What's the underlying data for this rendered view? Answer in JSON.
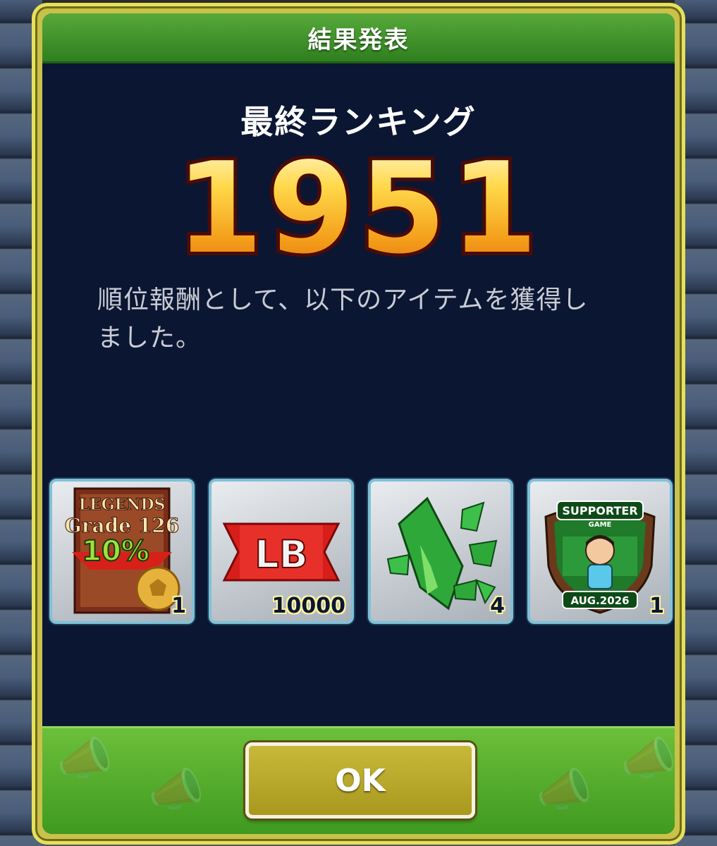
{
  "dialog": {
    "title": "結果発表",
    "ranking_label": "最終ランキング",
    "ranking_value": "1951",
    "message_line1": "順位報酬として、以下のアイテムを獲得し",
    "message_line2": "ました。",
    "ok_label": "OK"
  },
  "rewards": [
    {
      "name": "legends-grade-ticket",
      "top_text": "LEGENDS",
      "mid_text": "Grade 126",
      "pct_text": "10%",
      "count": "1"
    },
    {
      "name": "lb-coin",
      "badge_text": "LB",
      "count": "10000"
    },
    {
      "name": "green-crystal-shards",
      "count": "4"
    },
    {
      "name": "supporter-badge",
      "top_text": "SUPPORTER",
      "sub_text": "GAME",
      "date_text": "AUG.2026",
      "count": "1"
    }
  ],
  "colors": {
    "title_bar": "#3f9a2a",
    "dialog_bg": "#0b1633",
    "frame": "#e7e05a",
    "ok_button": "#b8a82a",
    "ranking_gold": "#f7c531",
    "ranking_outline": "#5a0d06"
  },
  "icons": [
    "megaphone-icon",
    "scarf-icon"
  ]
}
